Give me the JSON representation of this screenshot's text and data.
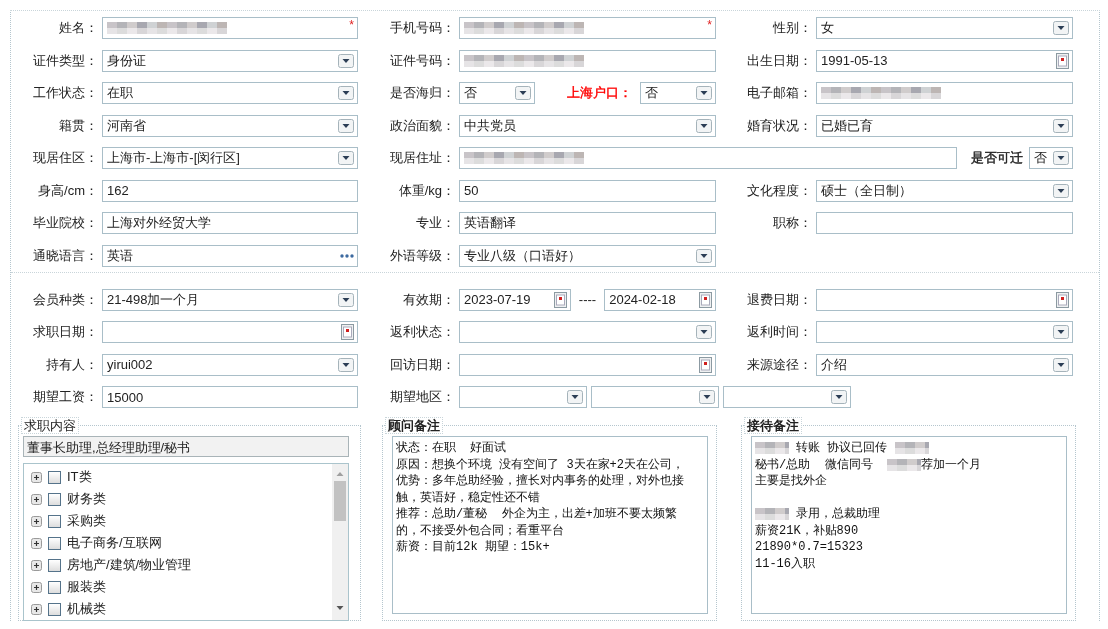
{
  "sections": [
    {
      "rows": [
        [
          {
            "kind": "normal",
            "label": "姓名：",
            "parts": [
              {
                "kind": "text",
                "redacted": true,
                "required_mark": "*"
              }
            ]
          },
          {
            "kind": "normal",
            "label": "手机号码：",
            "parts": [
              {
                "kind": "text",
                "redacted": true,
                "required_mark": "*"
              }
            ]
          },
          {
            "kind": "normal",
            "label": "性别：",
            "parts": [
              {
                "kind": "select",
                "value": "女"
              }
            ]
          }
        ],
        [
          {
            "kind": "normal",
            "label": "证件类型：",
            "parts": [
              {
                "kind": "select",
                "value": "身份证"
              }
            ]
          },
          {
            "kind": "normal",
            "label": "证件号码：",
            "parts": [
              {
                "kind": "text",
                "redacted": true
              }
            ]
          },
          {
            "kind": "normal",
            "label": "出生日期：",
            "parts": [
              {
                "kind": "date",
                "value": "1991-05-13"
              }
            ]
          }
        ],
        [
          {
            "kind": "normal",
            "label": "工作状态：",
            "parts": [
              {
                "kind": "select",
                "value": "在职"
              }
            ]
          },
          {
            "kind": "normal",
            "label": "是否海归：",
            "parts": [
              {
                "kind": "select",
                "value": "否"
              },
              {
                "kind": "caption",
                "text": "上海户口：",
                "color": "#ff0000"
              },
              {
                "kind": "select",
                "value": "否"
              }
            ]
          },
          {
            "kind": "normal",
            "label": "电子邮箱：",
            "parts": [
              {
                "kind": "text",
                "redacted": true
              }
            ]
          }
        ],
        [
          {
            "kind": "normal",
            "label": "籍贯：",
            "parts": [
              {
                "kind": "select",
                "value": "河南省"
              }
            ]
          },
          {
            "kind": "normal",
            "label": "政治面貌：",
            "parts": [
              {
                "kind": "select",
                "value": "中共党员"
              }
            ]
          },
          {
            "kind": "normal",
            "label": "婚育状况：",
            "parts": [
              {
                "kind": "select",
                "value": "已婚已育"
              }
            ]
          }
        ],
        [
          {
            "kind": "normal",
            "label": "现居住区：",
            "parts": [
              {
                "kind": "select",
                "value": "上海市-上海市-[闵行区]"
              }
            ]
          },
          {
            "kind": "wide",
            "label": "现居住址：",
            "parts": [
              {
                "kind": "text",
                "redacted": true
              },
              {
                "kind": "caption",
                "text": "是否可迁",
                "color": "#222222"
              },
              {
                "kind": "select",
                "value": "否"
              }
            ]
          }
        ],
        [
          {
            "kind": "normal",
            "label": "身高/cm：",
            "parts": [
              {
                "kind": "text",
                "value": "162"
              }
            ]
          },
          {
            "kind": "normal",
            "label": "体重/kg：",
            "parts": [
              {
                "kind": "text",
                "value": "50"
              }
            ]
          },
          {
            "kind": "normal",
            "label": "文化程度：",
            "parts": [
              {
                "kind": "select",
                "value": "硕士（全日制）"
              }
            ]
          }
        ],
        [
          {
            "kind": "normal",
            "label": "毕业院校：",
            "parts": [
              {
                "kind": "text",
                "value": "上海对外经贸大学"
              }
            ]
          },
          {
            "kind": "normal",
            "label": "专业：",
            "parts": [
              {
                "kind": "text",
                "value": "英语翻译"
              }
            ]
          },
          {
            "kind": "normal",
            "label": "职称：",
            "parts": [
              {
                "kind": "text"
              }
            ]
          }
        ],
        [
          {
            "kind": "normal",
            "label": "通晓语言：",
            "parts": [
              {
                "kind": "lookup",
                "value": "英语"
              }
            ]
          },
          {
            "kind": "normal",
            "label": "外语等级：",
            "parts": [
              {
                "kind": "select",
                "value": "专业八级（口语好）"
              }
            ]
          }
        ]
      ]
    },
    {
      "rows": [
        [
          {
            "kind": "normal",
            "label": "会员种类：",
            "parts": [
              {
                "kind": "select",
                "value": "21-498加一个月"
              }
            ]
          },
          {
            "kind": "normal",
            "label": "有效期：",
            "parts": [
              {
                "kind": "date",
                "value": "2023-07-19"
              },
              {
                "kind": "sep",
                "text": "----"
              },
              {
                "kind": "date",
                "value": "2024-02-18"
              }
            ]
          },
          {
            "kind": "normal",
            "label": "退费日期：",
            "parts": [
              {
                "kind": "date"
              }
            ]
          }
        ],
        [
          {
            "kind": "normal",
            "label": "求职日期：",
            "parts": [
              {
                "kind": "date"
              }
            ]
          },
          {
            "kind": "normal",
            "label": "返利状态：",
            "parts": [
              {
                "kind": "select"
              }
            ]
          },
          {
            "kind": "normal",
            "label": "返利时间：",
            "parts": [
              {
                "kind": "select"
              }
            ]
          }
        ],
        [
          {
            "kind": "normal",
            "label": "持有人：",
            "parts": [
              {
                "kind": "select",
                "value": "yirui002"
              }
            ]
          },
          {
            "kind": "normal",
            "label": "回访日期：",
            "parts": [
              {
                "kind": "date"
              }
            ]
          },
          {
            "kind": "normal",
            "label": "来源途径：",
            "parts": [
              {
                "kind": "select",
                "value": "介绍"
              }
            ]
          }
        ],
        [
          {
            "kind": "normal",
            "label": "期望工资：",
            "parts": [
              {
                "kind": "text",
                "value": "15000"
              }
            ]
          },
          {
            "kind": "regions",
            "label": "期望地区：",
            "parts": [
              {
                "kind": "select"
              },
              {
                "kind": "select"
              },
              {
                "kind": "select"
              }
            ]
          }
        ]
      ]
    }
  ],
  "groups": [
    {
      "kind": "tree",
      "title": "求职内容",
      "summary": "董事长助理,总经理助理/秘书",
      "items": [
        {
          "label": "IT类",
          "checked": false,
          "expanded": false
        },
        {
          "label": "财务类",
          "checked": false,
          "expanded": false
        },
        {
          "label": "采购类",
          "checked": false,
          "expanded": false
        },
        {
          "label": "电子商务/互联网",
          "checked": false,
          "expanded": false
        },
        {
          "label": "房地产/建筑/物业管理",
          "checked": false,
          "expanded": false
        },
        {
          "label": "服装类",
          "checked": false,
          "expanded": false
        },
        {
          "label": "机械类",
          "checked": false,
          "expanded": false
        }
      ]
    },
    {
      "kind": "notes",
      "title": "顾问备注",
      "lines": [
        {
          "segments": [
            {
              "kind": "text",
              "text": "状态：在职  好面试"
            }
          ]
        },
        {
          "segments": [
            {
              "kind": "text",
              "text": "原因：想换个环境 没有空间了 3天在家+2天在公司，"
            }
          ]
        },
        {
          "segments": [
            {
              "kind": "text",
              "text": "优势：多年总助经验，擅长对内事务的处理，对外也接"
            }
          ]
        },
        {
          "segments": [
            {
              "kind": "text",
              "text": "触，英语好，稳定性还不错"
            }
          ]
        },
        {
          "segments": [
            {
              "kind": "text",
              "text": "推荐：总助/董秘  外企为主，出差+加班不要太频繁"
            }
          ]
        },
        {
          "segments": [
            {
              "kind": "text",
              "text": "的，不接受外包合同；看重平台"
            }
          ]
        },
        {
          "segments": [
            {
              "kind": "text",
              "text": "薪资：目前12k 期望：15k+"
            }
          ]
        }
      ]
    },
    {
      "kind": "notes",
      "title": "接待备注",
      "lines": [
        {
          "segments": [
            {
              "kind": "redacted"
            },
            {
              "kind": "text",
              "text": " 转账 协议已回传 "
            },
            {
              "kind": "redacted"
            }
          ]
        },
        {
          "segments": [
            {
              "kind": "text",
              "text": "秘书/总助  微信同号  "
            },
            {
              "kind": "redacted"
            },
            {
              "kind": "text",
              "text": "荐加一个月"
            }
          ]
        },
        {
          "segments": [
            {
              "kind": "text",
              "text": "主要是找外企"
            }
          ]
        },
        {
          "gap_before": true,
          "segments": [
            {
              "kind": "redacted"
            },
            {
              "kind": "text",
              "text": " 录用，总裁助理"
            }
          ]
        },
        {
          "segments": [
            {
              "kind": "text",
              "text": "薪资21K，补贴890"
            }
          ]
        },
        {
          "segments": [
            {
              "kind": "text",
              "text": "21890*0.7=15323"
            }
          ]
        },
        {
          "segments": [
            {
              "kind": "text",
              "text": "11-16入职"
            }
          ]
        }
      ]
    }
  ]
}
